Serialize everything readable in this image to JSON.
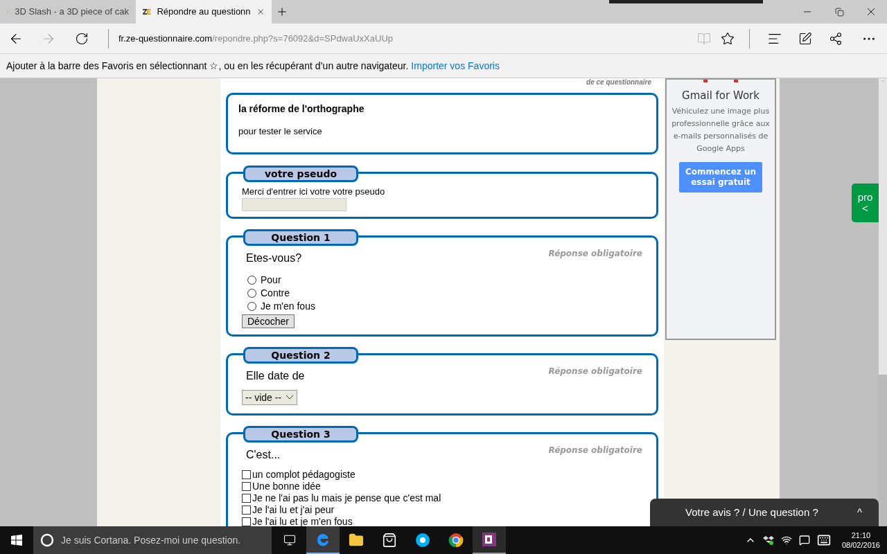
{
  "browser": {
    "tabs": [
      {
        "title": "3D Slash - a 3D piece of cak",
        "selected": false
      },
      {
        "title": "Répondre au questionn",
        "selected": true
      }
    ],
    "address": {
      "host": "fr.ze-questionnaire.com",
      "path": "/repondre.php?s=76092&d=SPdwaUxXaUUp"
    },
    "favorites_bar": {
      "text": "Ajouter à la barre des Favoris en sélectionnant ☆, ou en les récupérant d’un autre navigateur.",
      "link": "Importer vos Favoris"
    }
  },
  "page": {
    "header_note": "de ce questionnaire",
    "intro": {
      "title": "la réforme de l'orthographe",
      "subtitle": "pour tester le service"
    },
    "pseudo": {
      "legend": "votre pseudo",
      "label": "Merci d'entrer ici votre votre pseudo"
    },
    "questions": [
      {
        "kind": "radio",
        "legend": "Question 1",
        "required": "Réponse obligatoire",
        "prompt": "Etes-vous?",
        "options": [
          {
            "label": "Pour",
            "checked": false
          },
          {
            "label": "Contre",
            "checked": false
          },
          {
            "label": "Je m'en fous",
            "checked": false
          }
        ],
        "clear_button": "Décocher"
      },
      {
        "kind": "select",
        "legend": "Question 2",
        "required": "Réponse obligatoire",
        "prompt": "Elle date de",
        "value": "-- vide --"
      },
      {
        "kind": "checkbox",
        "legend": "Question 3",
        "required": "Réponse obligatoire",
        "prompt": "C'est...",
        "options": [
          {
            "label": "un complot pédagogiste",
            "checked": false
          },
          {
            "label": "Une bonne idée",
            "checked": false
          },
          {
            "label": "Je ne l'ai pas lu mais je pense que c'est mal",
            "checked": false
          },
          {
            "label": "Je l'ai lu et j'ai peur",
            "checked": false
          },
          {
            "label": "Je l'ai lu et je m'en fous",
            "checked": false
          }
        ]
      }
    ],
    "ad": {
      "title": "Gmail for Work",
      "body": "Véhiculez une image plus professionnelle grâce aux e-mails personnalisés de Google Apps",
      "button": "Commencez un essai gratuit"
    },
    "side_tab": {
      "label": "pro",
      "arrow": "<"
    },
    "feedback": {
      "label": "Votre avis ? / Une question ?",
      "arrow": "^"
    }
  },
  "taskbar": {
    "search_placeholder": "Je suis Cortana. Posez-moi une question.",
    "time": "21:10",
    "date": "08/02/2016"
  }
}
